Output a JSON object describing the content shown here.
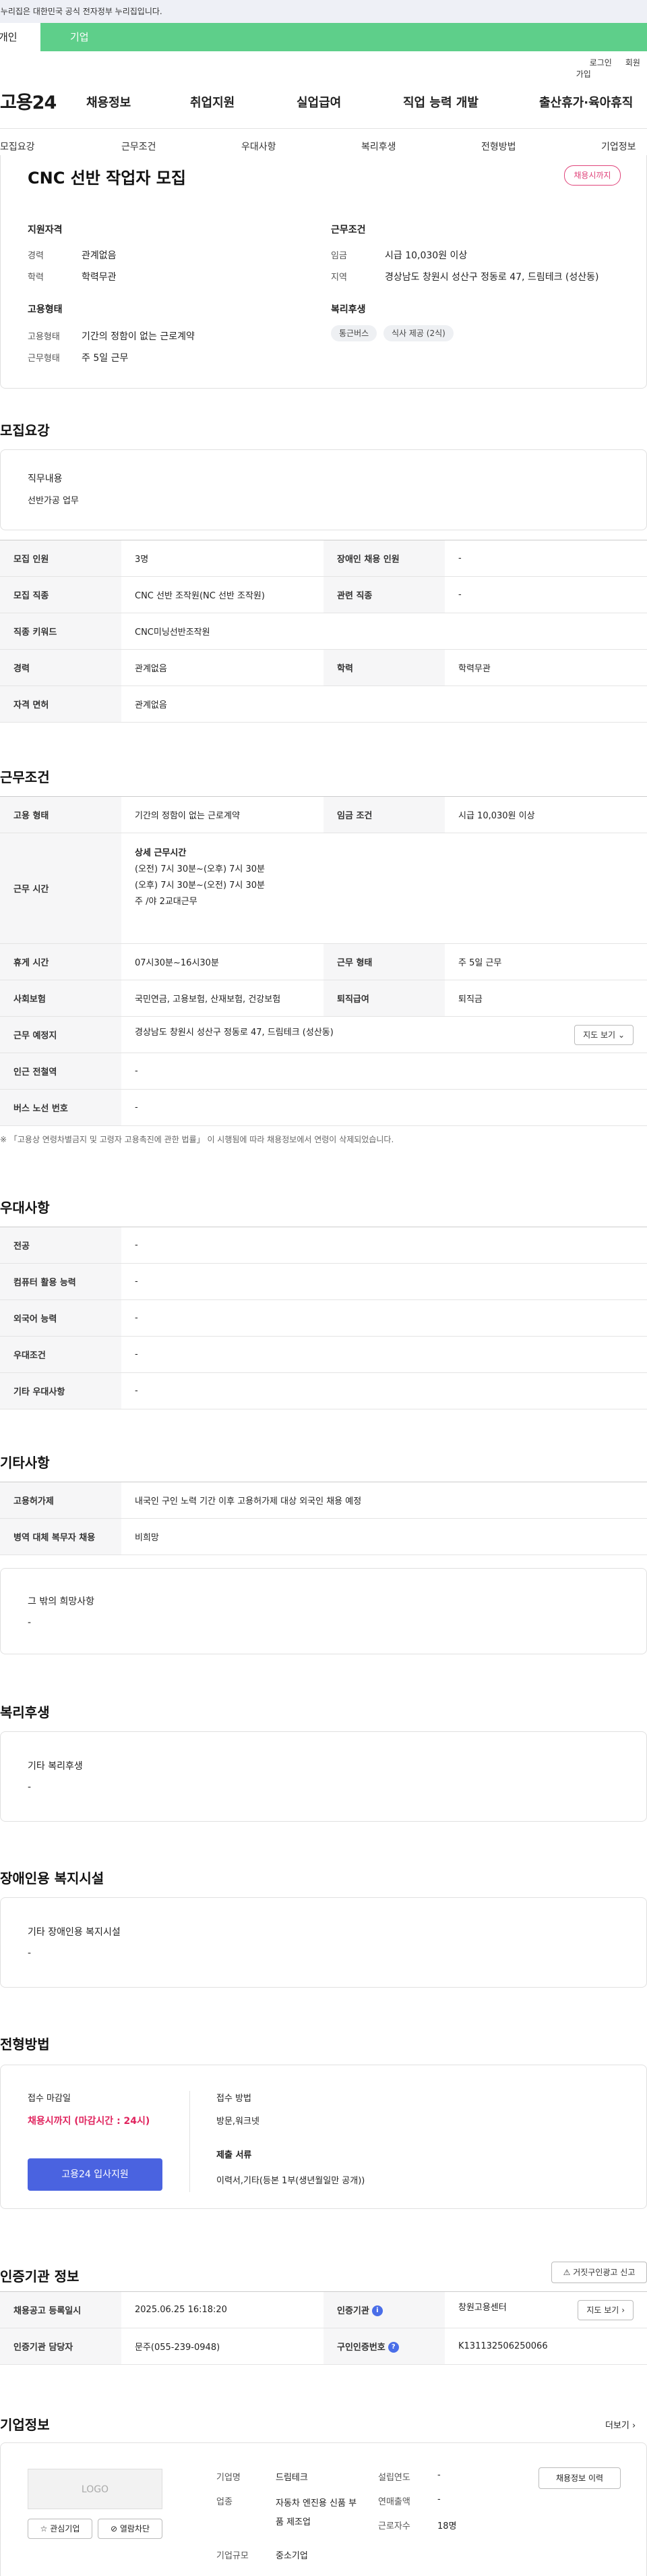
{
  "top": {
    "gov_text": "이 누리집은 대한민국 공식 전자정부 누리집입니다.",
    "tab_personal": "개인",
    "tab_company": "기업",
    "login": "로그인",
    "join": "회원가입"
  },
  "header": {
    "logo": "고용24",
    "nav": [
      "채용정보",
      "취업지원",
      "실업급여",
      "직업 능력 개발",
      "출산휴가·육아휴직"
    ]
  },
  "subnav": [
    "모집요강",
    "근무조건",
    "우대사항",
    "복리후생",
    "전형방법",
    "기업정보"
  ],
  "summary": {
    "title": "CNC 선반 작업자 모집",
    "badge": "채용시까지",
    "qual_title": "지원자격",
    "career_lbl": "경력",
    "career": "관계없음",
    "edu_lbl": "학력",
    "edu": "학력무관",
    "emp_title": "고용형태",
    "emptype_lbl": "고용형태",
    "emptype": "기간의 정함이 없는 근로계약",
    "worktype_lbl": "근무형태",
    "worktype": "주 5일 근무",
    "cond_title": "근무조건",
    "wage_lbl": "임금",
    "wage": "시급 10,030원 이상",
    "region_lbl": "지역",
    "region": "경상남도 창원시 성산구 정동로 47, 드림테크 (성산동)",
    "welfare_title": "복리후생",
    "chips": [
      "통근버스",
      "식사 제공 (2식)"
    ]
  },
  "recruit": {
    "section": "모집요강",
    "duty_title": "직무내용",
    "duty": "선반가공  업무",
    "rows": [
      [
        "모집 인원",
        "3명",
        "장애인 채용 인원",
        "-"
      ],
      [
        "모집 직종",
        "CNC 선반 조작원(NC 선반 조작원)",
        "관련 직종",
        "-"
      ],
      [
        "직종 키워드",
        "CNC미닝선반조작원"
      ],
      [
        "경력",
        "관계없음",
        "학력",
        "학력무관"
      ],
      [
        "자격 면허",
        "관계없음"
      ]
    ]
  },
  "work": {
    "section": "근무조건",
    "emp_lbl": "고용 형태",
    "emp": "기간의 정함이 없는 근로계약",
    "wage_lbl": "임금 조건",
    "wage": "시급 10,030원 이상",
    "hours_lbl": "근무 시간",
    "hours_title": "상세 근무시간",
    "hours": [
      "(오전) 7시 30분~(오후) 7시 30분",
      "(오후) 7시 30분~(오전) 7시 30분",
      "주 /야  2교대근무"
    ],
    "rest_lbl": "휴게 시간",
    "rest": "07시30분~16시30분",
    "form_lbl": "근무 형태",
    "form": "주 5일 근무",
    "ins_lbl": "사회보험",
    "ins": "국민연금, 고용보험, 산재보험, 건강보험",
    "ret_lbl": "퇴직급여",
    "ret": "퇴직금",
    "place_lbl": "근무 예정지",
    "place": "경상남도 창원시 성산구 정동로 47, 드림테크 (성산동)",
    "map_btn": "지도 보기",
    "sub_lbl": "인근 전철역",
    "sub": "-",
    "bus_lbl": "버스 노선 번호",
    "bus": "-",
    "note": "※ 「고용상 연령차별금지 및 고령자 고용촉진에 관한 법률」 이 시행됨에 따라 채용정보에서 연령이 삭제되었습니다."
  },
  "pref": {
    "section": "우대사항",
    "rows": [
      [
        "전공",
        "-"
      ],
      [
        "컴퓨터 활용 능력",
        "-"
      ],
      [
        "외국어 능력",
        "-"
      ],
      [
        "우대조건",
        "-"
      ],
      [
        "기타 우대사항",
        "-"
      ]
    ]
  },
  "etc": {
    "section": "기타사항",
    "rows": [
      [
        "고용허가제",
        "내국인 구인 노력 기간 이후 고용허가제 대상 외국인 채용 예정"
      ],
      [
        "병역 대체 복무자 채용",
        "비희망"
      ]
    ],
    "other_title": "그 밖의 희망사항",
    "other": "-"
  },
  "welfare": {
    "section": "복리후생",
    "title": "기타 복리후생",
    "value": "-"
  },
  "disab": {
    "section": "장애인용 복지시설",
    "title": "기타 장애인용 복지시설",
    "value": "-"
  },
  "screen": {
    "section": "전형방법",
    "deadline_lbl": "접수 마감일",
    "deadline": "채용시까지 (마감시간 : 24시)",
    "apply_btn": "고용24 입사지원",
    "method_lbl": "접수 방법",
    "method": "방문,워크넷",
    "docs_lbl": "제출 서류",
    "docs": "이력서,기타(등본 1부(생년월일만 공개))"
  },
  "agency": {
    "section": "인증기관 정보",
    "report_btn": "거짓구인광고 신고",
    "reg_lbl": "채용공고 등록일시",
    "reg": "2025.06.25 16:18:20",
    "org_lbl": "인증기관",
    "org": "창원고용센터",
    "map_btn": "지도 보기",
    "mgr_lbl": "인증기관 담당자",
    "mgr": "문주(055-239-0948)",
    "num_lbl": "구인인증번호",
    "num": "K131132506250066"
  },
  "company": {
    "section": "기업정보",
    "more": "더보기",
    "logo": "LOGO",
    "fav_btn": "관심기업",
    "block_btn": "열람차단",
    "name_lbl": "기업명",
    "name": "드림테크",
    "ind_lbl": "업종",
    "ind": "자동차 엔진용 신품 부품 제조업",
    "size_lbl": "기업규모",
    "size": "중소기업",
    "est_lbl": "설립연도",
    "est": "-",
    "sales_lbl": "연매출액",
    "sales": "-",
    "emp_lbl": "근로자수",
    "emp": "18명",
    "history_btn": "채용정보 이력"
  }
}
